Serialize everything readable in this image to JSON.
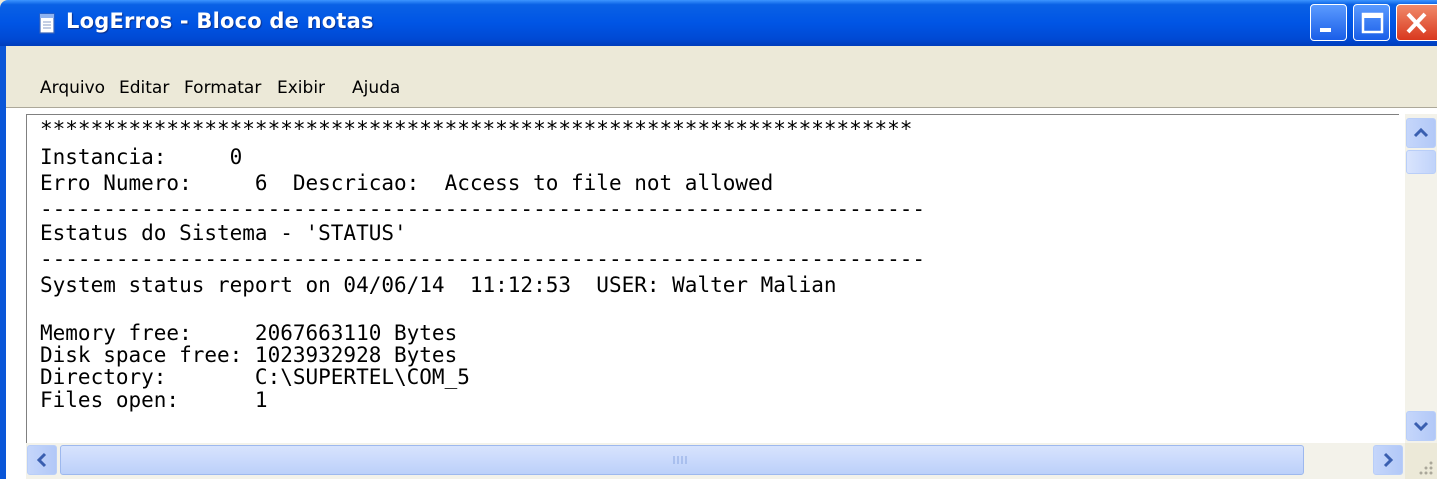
{
  "window": {
    "title": "LogErros - Bloco de notas",
    "accent_color": "#0a56d8",
    "close_color": "#d9381e"
  },
  "menu": {
    "items": [
      "Arquivo",
      "Editar",
      "Formatar",
      "Exibir",
      "Ajuda"
    ]
  },
  "document": {
    "lines": [
      "*********************************************************************",
      "Instancia:     0",
      "Erro Numero:     6  Descricao:  Access to file not allowed",
      "----------------------------------------------------------------------",
      "Estatus do Sistema - 'STATUS'",
      "----------------------------------------------------------------------",
      "System status report on 04/06/14  11:12:53  USER: Walter Malian",
      "",
      "Memory free:     2067663110 Bytes",
      "Disk space free: 1023932928 Bytes",
      "Directory:       C:\\SUPERTEL\\COM_5",
      "Files open:      1"
    ]
  },
  "icons": {
    "app": "notepad-icon",
    "minimize": "minimize-icon",
    "maximize": "maximize-icon",
    "close": "close-icon",
    "scroll_up": "arrow-up-icon",
    "scroll_down": "arrow-down-icon",
    "scroll_left": "arrow-left-icon",
    "scroll_right": "arrow-right-icon",
    "size_grip": "size-grip-icon"
  }
}
